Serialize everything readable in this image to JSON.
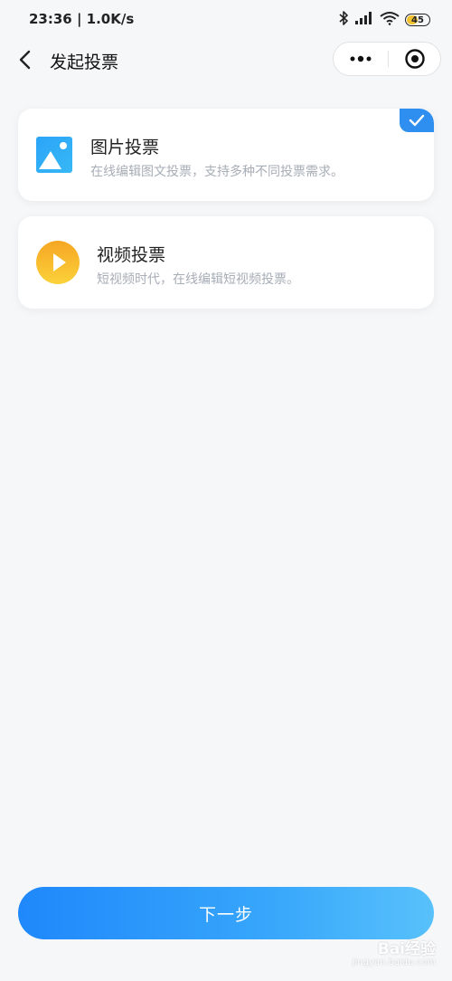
{
  "status_bar": {
    "time": "23:36 | 1.0K/s",
    "battery": "45",
    "icons": [
      "bluetooth-icon",
      "signal-icon",
      "wifi-icon",
      "battery-icon"
    ]
  },
  "nav": {
    "title": "发起投票",
    "back_icon": "back-arrow-icon",
    "more_icon": "more-dots-icon",
    "close_icon": "target-close-icon"
  },
  "options": [
    {
      "title": "图片投票",
      "desc": "在线编辑图文投票，支持多种不同投票需求。",
      "icon": "image-icon",
      "selected": true
    },
    {
      "title": "视频投票",
      "desc": "短视频时代，在线编辑短视频投票。",
      "icon": "play-icon",
      "selected": false
    }
  ],
  "next_button": "下一步",
  "watermark": {
    "text": "Bai经验",
    "sub": "jingyan.baidu.com"
  },
  "colors": {
    "accent": "#2f8ff0",
    "button_start": "#1f88fb",
    "button_end": "#58c1fb",
    "desc": "#a7adb6"
  }
}
